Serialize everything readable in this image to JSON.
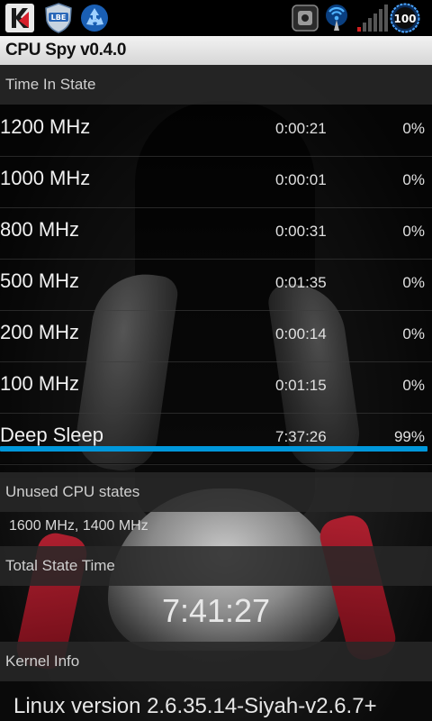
{
  "status_bar": {
    "icons": [
      "kaspersky-k-icon",
      "lbe-shield-icon",
      "recycle-icon",
      "app-icon",
      "wifi-tether-icon",
      "signal-icon",
      "battery-icon"
    ],
    "lbe_label": "LBE",
    "battery_level": "100"
  },
  "app": {
    "title": "CPU Spy v0.4.0"
  },
  "time_in_state": {
    "header": "Time In State",
    "states": [
      {
        "freq": "1200 MHz",
        "time": "0:00:21",
        "percent": "0%",
        "fraction": 0.0
      },
      {
        "freq": "1000 MHz",
        "time": "0:00:01",
        "percent": "0%",
        "fraction": 0.0
      },
      {
        "freq": "800 MHz",
        "time": "0:00:31",
        "percent": "0%",
        "fraction": 0.0
      },
      {
        "freq": "500 MHz",
        "time": "0:01:35",
        "percent": "0%",
        "fraction": 0.0
      },
      {
        "freq": "200 MHz",
        "time": "0:00:14",
        "percent": "0%",
        "fraction": 0.0
      },
      {
        "freq": "100 MHz",
        "time": "0:01:15",
        "percent": "0%",
        "fraction": 0.0
      },
      {
        "freq": "Deep Sleep",
        "time": "7:37:26",
        "percent": "99%",
        "fraction": 0.99
      }
    ],
    "bar_color": "#0097db"
  },
  "unused": {
    "header": "Unused CPU states",
    "value": "1600 MHz, 1400 MHz"
  },
  "total": {
    "header": "Total State Time",
    "value": "7:41:27"
  },
  "kernel": {
    "header": "Kernel Info",
    "value": "Linux version 2.6.35.14-Siyah-v2.6.7+"
  }
}
